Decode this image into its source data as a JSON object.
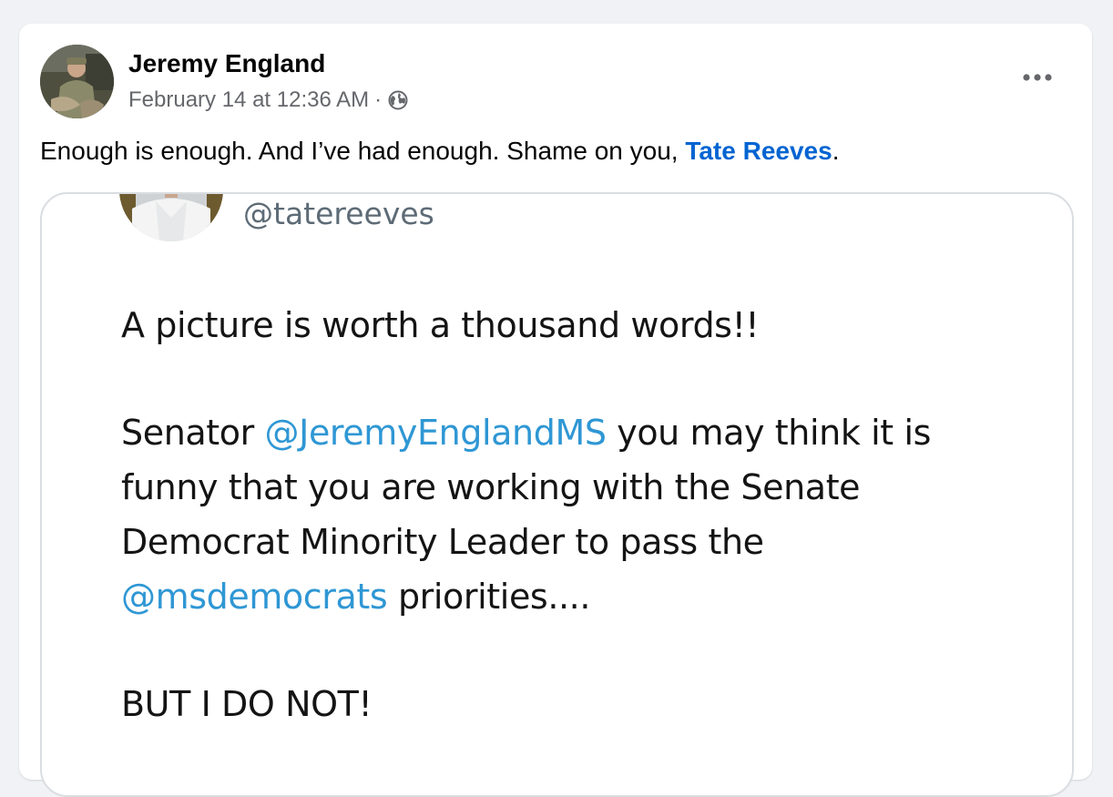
{
  "post": {
    "author_name": "Jeremy England",
    "timestamp": "February 14 at 12:36 AM",
    "separator": "·",
    "privacy_icon": "globe-icon",
    "more_icon": "more-horizontal-icon",
    "text_before": "Enough is enough. And I’ve had enough. Shame on you, ",
    "mention": "Tate Reeves",
    "text_after": "."
  },
  "shared_image": {
    "handle": "@tatereeves",
    "line1": "A picture is worth a thousand words!!",
    "line2_a": "Senator ",
    "line2_mention": "@JeremyEnglandMS",
    "line2_b": " you may think it is",
    "line3": "funny that you are working with the Senate",
    "line4": "Democrat Minority Leader to pass the",
    "line5_mention": "@msdemocrats",
    "line5_b": " priorities....",
    "line6": "BUT I DO NOT!"
  },
  "colors": {
    "background": "#f0f2f5",
    "card": "#ffffff",
    "link_blue": "#0064d1",
    "tweet_mention_blue": "#2f97d4",
    "meta_gray": "#65676b"
  }
}
